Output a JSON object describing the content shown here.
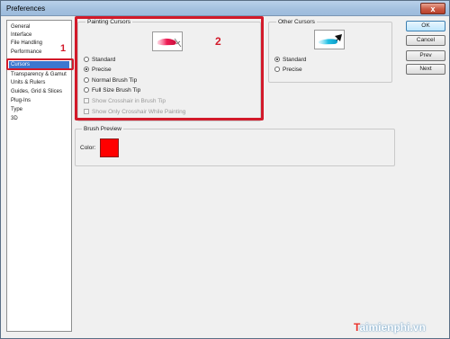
{
  "window": {
    "title": "Preferences",
    "close_label": "x"
  },
  "sidebar": {
    "items": [
      {
        "label": "General"
      },
      {
        "label": "Interface"
      },
      {
        "label": "File Handling"
      },
      {
        "label": "Performance"
      },
      {
        "label": "Cursors",
        "selected": true
      },
      {
        "label": "Transparency & Gamut"
      },
      {
        "label": "Units & Rulers"
      },
      {
        "label": "Guides, Grid & Slices"
      },
      {
        "label": "Plug-Ins"
      },
      {
        "label": "Type"
      },
      {
        "label": "3D"
      }
    ]
  },
  "annotations": {
    "marker_1": "1",
    "marker_2": "2",
    "color": "#d21a2a"
  },
  "painting_cursors": {
    "title": "Painting Cursors",
    "options": [
      {
        "label": "Standard",
        "type": "radio",
        "checked": false
      },
      {
        "label": "Precise",
        "type": "radio",
        "checked": true
      },
      {
        "label": "Normal Brush Tip",
        "type": "radio",
        "checked": false
      },
      {
        "label": "Full Size Brush Tip",
        "type": "radio",
        "checked": false
      },
      {
        "label": "Show Crosshair in Brush Tip",
        "type": "checkbox",
        "checked": false,
        "disabled": true
      },
      {
        "label": "Show Only Crosshair While Painting",
        "type": "checkbox",
        "checked": false,
        "disabled": true
      }
    ]
  },
  "other_cursors": {
    "title": "Other Cursors",
    "options": [
      {
        "label": "Standard",
        "type": "radio",
        "checked": true
      },
      {
        "label": "Precise",
        "type": "radio",
        "checked": false
      }
    ]
  },
  "brush_preview": {
    "title": "Brush Preview",
    "color_label": "Color:",
    "color": "#ff0000"
  },
  "buttons": {
    "ok": "OK",
    "cancel": "Cancel",
    "prev": "Prev",
    "next": "Next"
  },
  "watermark": {
    "prefix": "T",
    "rest": "aimienphi",
    "suffix": ".vn"
  }
}
